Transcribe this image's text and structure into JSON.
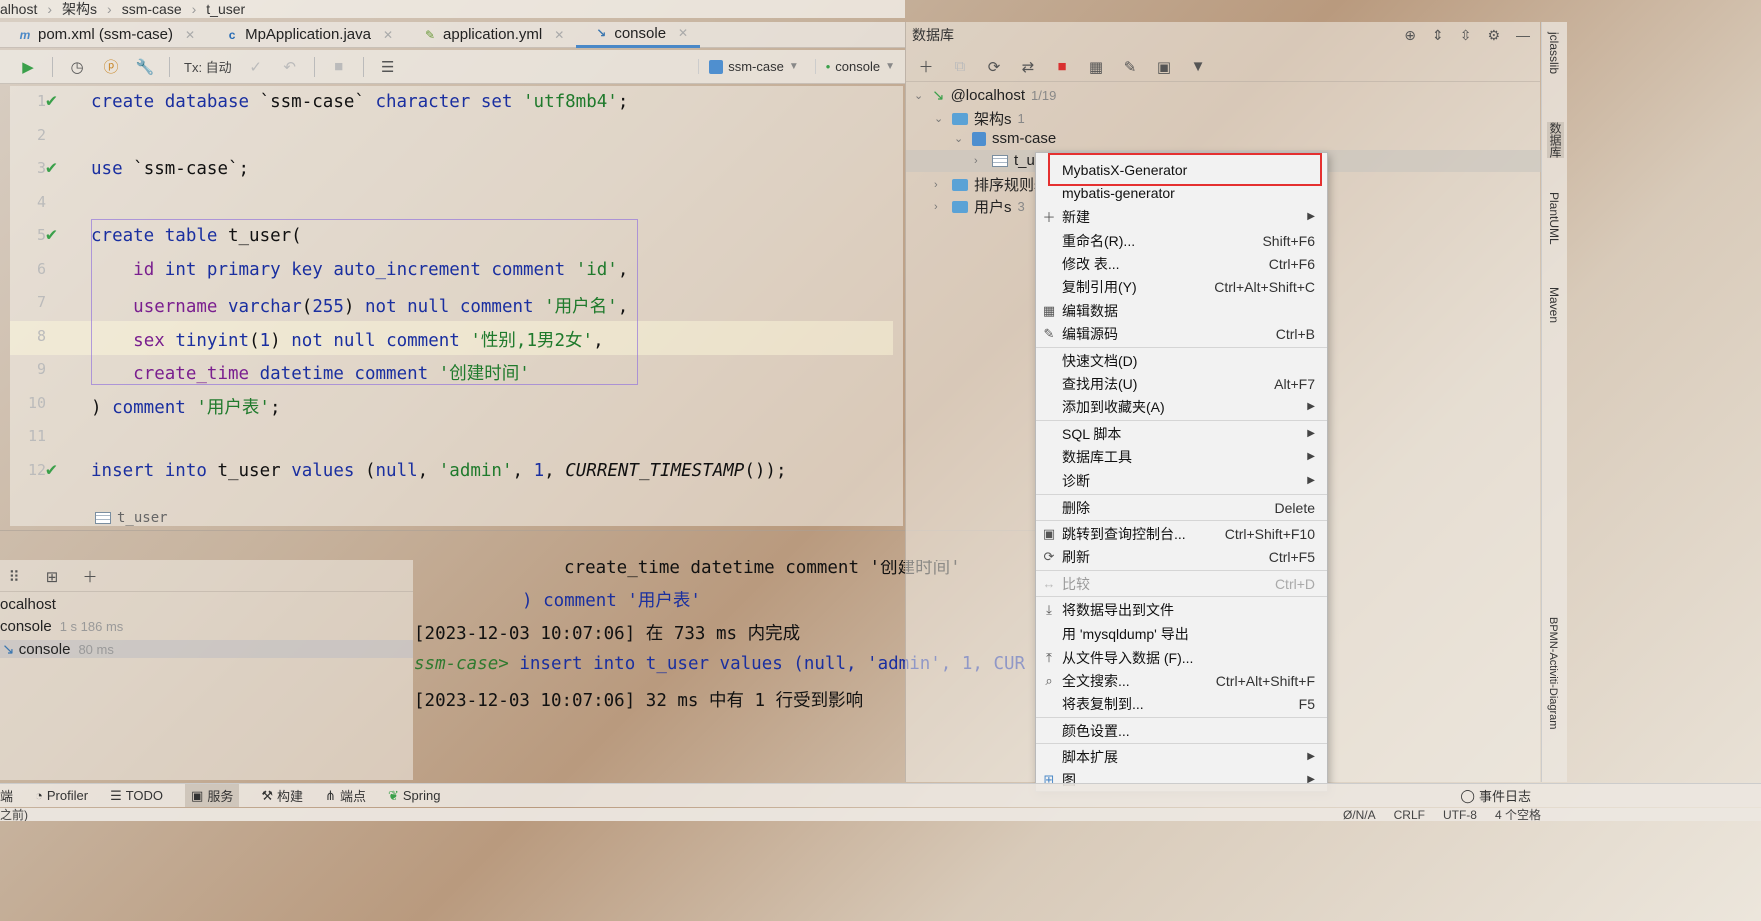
{
  "breadcrumb": [
    "alhost",
    "架构s",
    "ssm-case",
    "t_user"
  ],
  "tabs": [
    {
      "icon": "m",
      "label": "pom.xml (ssm-case)"
    },
    {
      "icon": "c",
      "label": "MpApplication.java"
    },
    {
      "icon": "y",
      "label": "application.yml"
    },
    {
      "icon": "console",
      "label": "console"
    }
  ],
  "editor_toolbar": {
    "tx_label": "Tx: 自动",
    "schema_selector": "ssm-case",
    "session_selector": "console"
  },
  "editor": {
    "line_numbers": [
      "1",
      "2",
      "3",
      "4",
      "5",
      "6",
      "7",
      "8",
      "9",
      "10",
      "11",
      "12"
    ],
    "breadcrumb": "t_user"
  },
  "services": {
    "items": [
      "ocalhost",
      "console",
      "console"
    ],
    "times": [
      "",
      "1 s 186 ms",
      "80 ms"
    ]
  },
  "console_output": {
    "line1": "create_time datetime comment '创建时间'",
    "line2": ") comment '用户表'",
    "line3": "[2023-12-03 10:07:06] 在 733 ms 内完成",
    "line4_prompt": "ssm-case>",
    "line4_sql": " insert into t_user values (null, 'admin', 1, CUR",
    "line5": "[2023-12-03 10:07:06] 32 ms 中有 1 行受到影响"
  },
  "db_panel": {
    "title": "数据库",
    "host": "@localhost",
    "host_count": "1/19",
    "schema_group": "架构s",
    "schema_group_count": "1",
    "schema": "ssm-case",
    "table": "t_u",
    "collations": "排序规则s",
    "users": "用户s",
    "users_count": "3"
  },
  "right_stripe": [
    "jclasslib",
    "数据库",
    "PlantUML",
    "Maven",
    "BPMN-Activiti-Diagram"
  ],
  "context_menu": {
    "items": [
      {
        "label": "MybatisX-Generator",
        "shortcut": ""
      },
      {
        "label": "mybatis-generator",
        "shortcut": ""
      },
      {
        "label": "新建",
        "shortcut": ""
      },
      {
        "label": "重命名(R)...",
        "shortcut": "Shift+F6"
      },
      {
        "label": "修改 表...",
        "shortcut": "Ctrl+F6"
      },
      {
        "label": "复制引用(Y)",
        "shortcut": "Ctrl+Alt+Shift+C"
      },
      {
        "label": "编辑数据",
        "shortcut": ""
      },
      {
        "label": "编辑源码",
        "shortcut": "Ctrl+B"
      },
      {
        "label": "快速文档(D)",
        "shortcut": ""
      },
      {
        "label": "查找用法(U)",
        "shortcut": "Alt+F7"
      },
      {
        "label": "添加到收藏夹(A)",
        "shortcut": ""
      },
      {
        "label": "SQL 脚本",
        "shortcut": ""
      },
      {
        "label": "数据库工具",
        "shortcut": ""
      },
      {
        "label": "诊断",
        "shortcut": ""
      },
      {
        "label": "删除",
        "shortcut": "Delete"
      },
      {
        "label": "跳转到查询控制台...",
        "shortcut": "Ctrl+Shift+F10"
      },
      {
        "label": "刷新",
        "shortcut": "Ctrl+F5"
      },
      {
        "label": "比较",
        "shortcut": "Ctrl+D"
      },
      {
        "label": "将数据导出到文件",
        "shortcut": ""
      },
      {
        "label": "用 'mysqldump' 导出",
        "shortcut": ""
      },
      {
        "label": "从文件导入数据 (F)...",
        "shortcut": ""
      },
      {
        "label": "全文搜索...",
        "shortcut": "Ctrl+Alt+Shift+F"
      },
      {
        "label": "将表复制到...",
        "shortcut": "F5"
      },
      {
        "label": "颜色设置...",
        "shortcut": ""
      },
      {
        "label": "脚本扩展",
        "shortcut": ""
      },
      {
        "label": "图",
        "shortcut": ""
      }
    ]
  },
  "bottom_tools": [
    "端",
    "Profiler",
    "TODO",
    "服务",
    "构建",
    "端点",
    "Spring"
  ],
  "event_log": "事件日志",
  "status_bar": [
    "之前)",
    "Ø/N/A",
    "CRLF",
    "UTF-8",
    "4 个空格"
  ],
  "colors": {
    "highlight_box": "#e53030",
    "check": "#3aa04a",
    "keyword": "#1a2fa0",
    "string": "#1f7a2c"
  }
}
